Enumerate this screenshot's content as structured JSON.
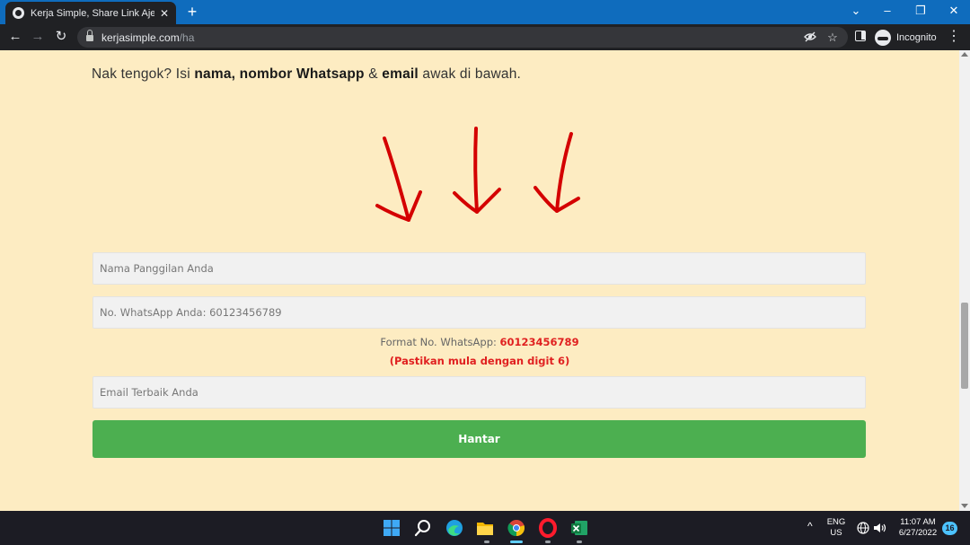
{
  "browser": {
    "tab_title": "Kerja Simple, Share Link Aje – VIP",
    "url_host": "kerjasimple.com",
    "url_path": "/ha",
    "incognito_label": "Incognito"
  },
  "page": {
    "intro_prefix": "Nak tengok? Isi ",
    "intro_bold1": "nama, nombor Whatsapp",
    "intro_mid": " & ",
    "intro_bold2": "email",
    "intro_suffix": " awak di bawah.",
    "arrow_color": "#d40000",
    "form": {
      "name_placeholder": "Nama Panggilan Anda",
      "whatsapp_placeholder": "No. WhatsApp Anda: 60123456789",
      "format_label": "Format No. WhatsApp: ",
      "format_example": "60123456789",
      "format_note": "(Pastikan mula dengan digit 6)",
      "email_placeholder": "Email Terbaik Anda",
      "submit_label": "Hantar",
      "submit_color": "#4caf50"
    }
  },
  "taskbar": {
    "lang_top": "ENG",
    "lang_bottom": "US",
    "time": "11:07 AM",
    "date": "6/27/2022",
    "notification_count": "16"
  }
}
